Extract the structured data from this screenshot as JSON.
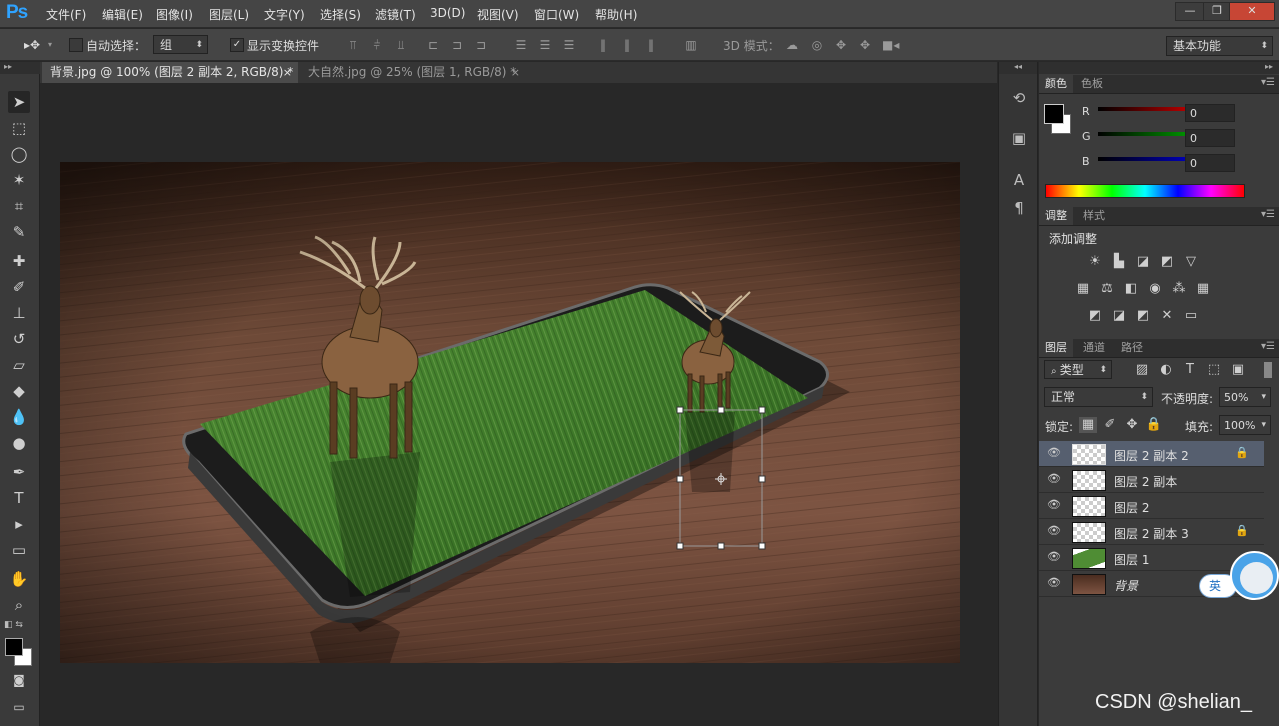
{
  "app": {
    "logo": "Ps"
  },
  "menu": [
    "文件(F)",
    "编辑(E)",
    "图像(I)",
    "图层(L)",
    "文字(Y)",
    "选择(S)",
    "滤镜(T)",
    "3D(D)",
    "视图(V)",
    "窗口(W)",
    "帮助(H)"
  ],
  "window_controls": {
    "minimize": "—",
    "restore": "❐",
    "close": "✕"
  },
  "options_bar": {
    "auto_select_label": "自动选择：",
    "auto_select_value": "组",
    "show_transform_label": "显示变换控件",
    "mode_3d_label": "3D 模式：",
    "workspace": "基本功能"
  },
  "doc_tabs": [
    {
      "label": "背景.jpg @ 100% (图层 2 副本 2, RGB/8) *",
      "close": "×",
      "active": true
    },
    {
      "label": "大自然.jpg @ 25% (图层 1, RGB/8) *",
      "close": "×",
      "active": false
    }
  ],
  "color_panel": {
    "tabs": [
      "颜色",
      "色板"
    ],
    "channels": [
      {
        "label": "R",
        "value": "0",
        "color": "#ff0000"
      },
      {
        "label": "G",
        "value": "0",
        "color": "#00c000"
      },
      {
        "label": "B",
        "value": "0",
        "color": "#0000ff"
      }
    ]
  },
  "adjustments_panel": {
    "tabs": [
      "调整",
      "样式"
    ],
    "title": "添加调整"
  },
  "layers_panel": {
    "tabs": [
      "图层",
      "通道",
      "路径"
    ],
    "filter_label": "类型",
    "blend_mode": "正常",
    "opacity_label": "不透明度:",
    "opacity_value": "50%",
    "lock_label": "锁定:",
    "fill_label": "填充:",
    "fill_value": "100%",
    "layers": [
      {
        "name": "图层 2 副本 2",
        "locked": true,
        "selected": true,
        "thumb": "transparent"
      },
      {
        "name": "图层 2 副本",
        "locked": false,
        "selected": false,
        "thumb": "transparent"
      },
      {
        "name": "图层 2",
        "locked": false,
        "selected": false,
        "thumb": "transparent"
      },
      {
        "name": "图层 2 副本 3",
        "locked": true,
        "selected": false,
        "thumb": "transparent"
      },
      {
        "name": "图层 1",
        "locked": false,
        "selected": false,
        "thumb": "grass"
      },
      {
        "name": "背景",
        "locked": false,
        "selected": false,
        "thumb": "wood"
      }
    ]
  },
  "ime_badge": "英",
  "watermark": "CSDN @shelian_"
}
